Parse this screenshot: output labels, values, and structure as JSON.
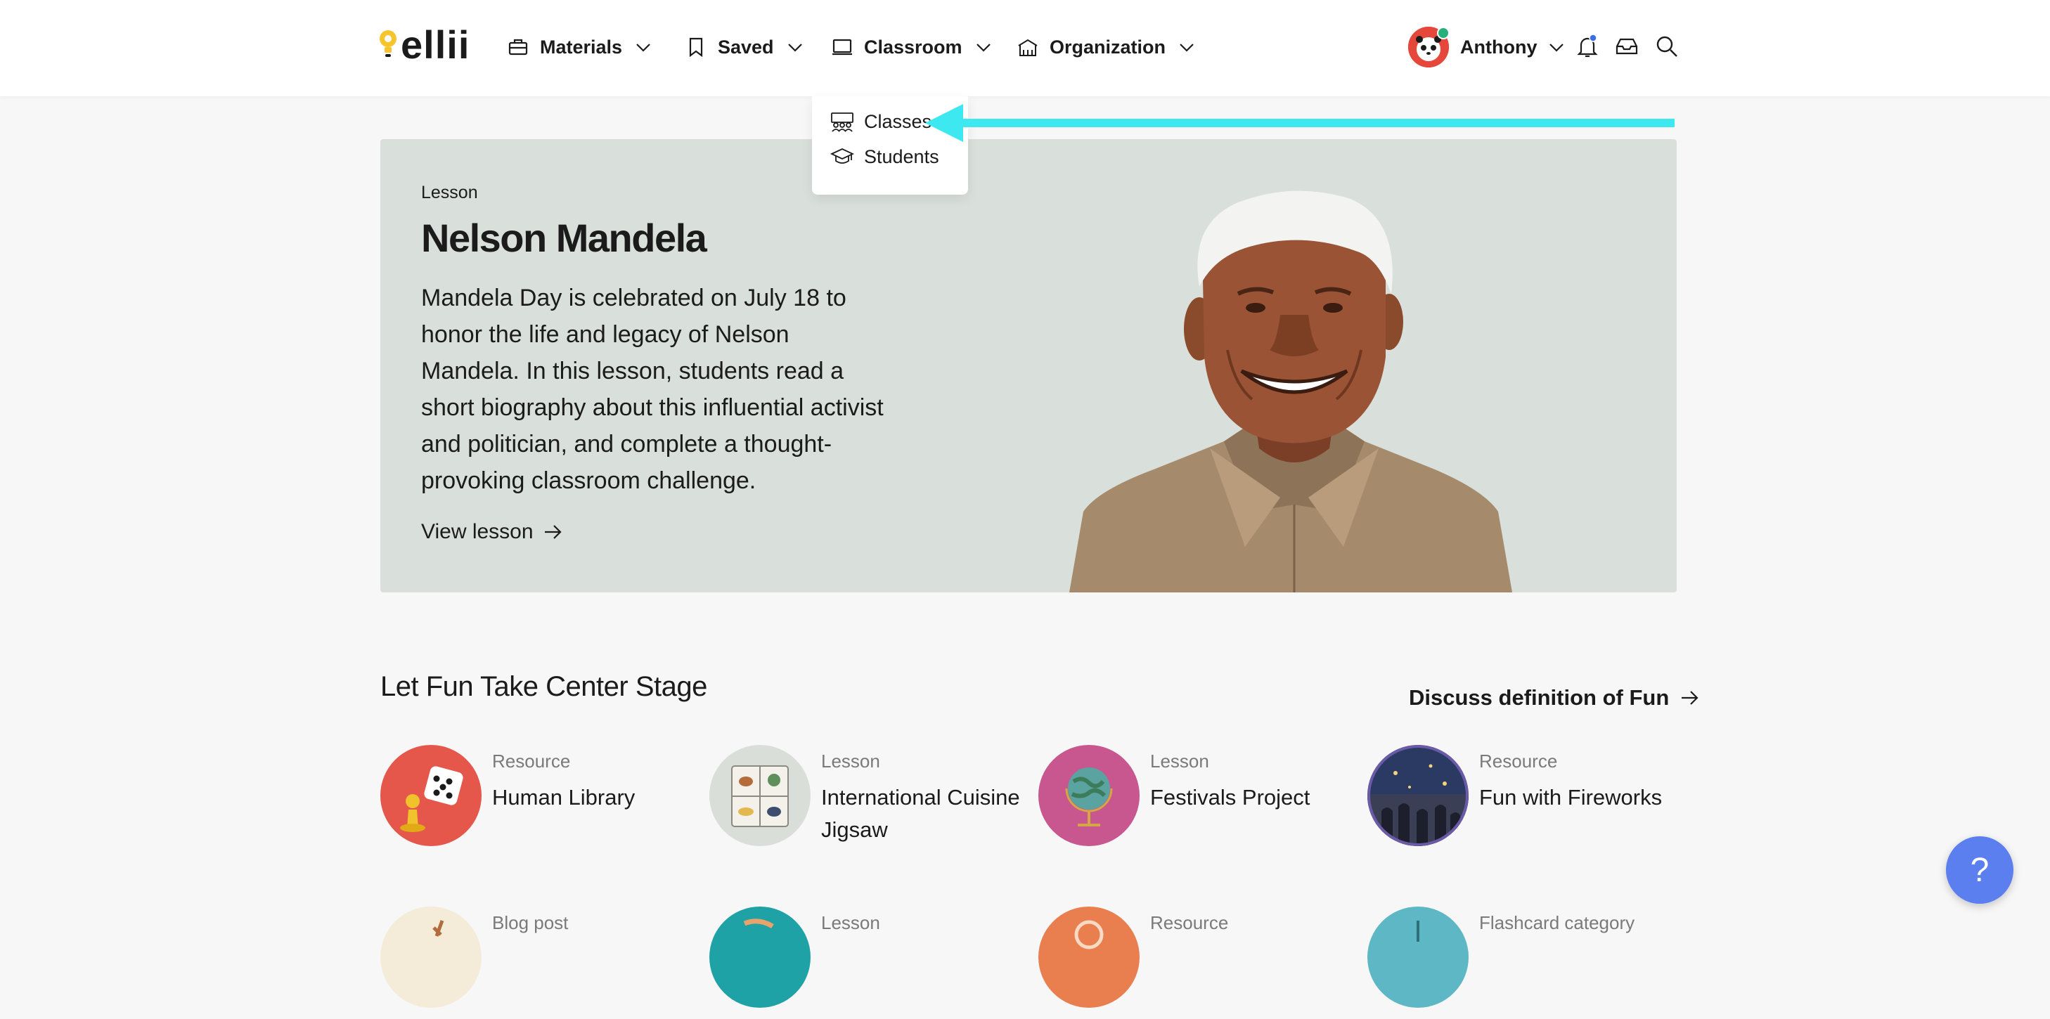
{
  "header": {
    "logo_text": "ellii",
    "nav": [
      {
        "label": "Materials",
        "icon": "briefcase-icon"
      },
      {
        "label": "Saved",
        "icon": "bookmark-icon"
      },
      {
        "label": "Classroom",
        "icon": "chalkboard-icon"
      },
      {
        "label": "Organization",
        "icon": "school-building-icon"
      }
    ],
    "user_name": "Anthony"
  },
  "classroom_menu": {
    "items": [
      {
        "label": "Classes",
        "icon": "classes-group-icon"
      },
      {
        "label": "Students",
        "icon": "graduation-cap-icon"
      }
    ]
  },
  "hero": {
    "type": "Lesson",
    "title": "Nelson Mandela",
    "description": "Mandela Day is celebrated on July 18 to honor the life and legacy of Nelson Mandela. In this lesson, students read a short biography about this influential activist and politician, and complete a thought-provoking classroom challenge.",
    "link": "View lesson"
  },
  "section": {
    "title": "Let Fun Take Center Stage",
    "link": "Discuss definition of Fun",
    "cards": [
      {
        "type": "Resource",
        "title": "Human Library"
      },
      {
        "type": "Lesson",
        "title": "International Cuisine Jigsaw"
      },
      {
        "type": "Lesson",
        "title": "Festivals Project"
      },
      {
        "type": "Resource",
        "title": "Fun with Fireworks"
      },
      {
        "type": "Blog post",
        "title": ""
      },
      {
        "type": "Lesson",
        "title": ""
      },
      {
        "type": "Resource",
        "title": ""
      },
      {
        "type": "Flashcard category",
        "title": ""
      }
    ]
  },
  "help_button": "?",
  "colors": {
    "accent_arrow": "#3ee8f0",
    "hero_bg": "#d9dfdb",
    "help_button": "#5b7fef",
    "notification_dot": "#3b6fe8",
    "status_dot": "#27b07a"
  }
}
